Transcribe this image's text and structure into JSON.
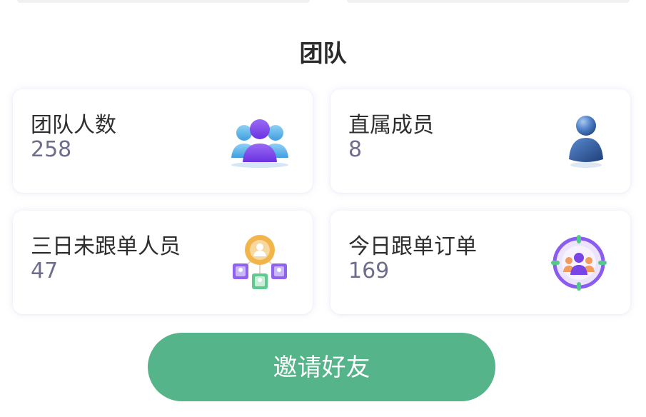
{
  "team": {
    "title": "团队",
    "cards": [
      {
        "label": "团队人数",
        "value": "258",
        "icon": "team-group-icon"
      },
      {
        "label": "直属成员",
        "value": "8",
        "icon": "member-person-icon"
      },
      {
        "label": "三日未跟单人员",
        "value": "47",
        "icon": "network-people-icon"
      },
      {
        "label": "今日跟单订单",
        "value": "169",
        "icon": "target-group-icon"
      }
    ],
    "invite_label": "邀请好友"
  },
  "colors": {
    "accent": "#55b489",
    "value_text": "#6f6d8c",
    "purple": "#7a45e6",
    "blue": "#3d6fb8"
  }
}
